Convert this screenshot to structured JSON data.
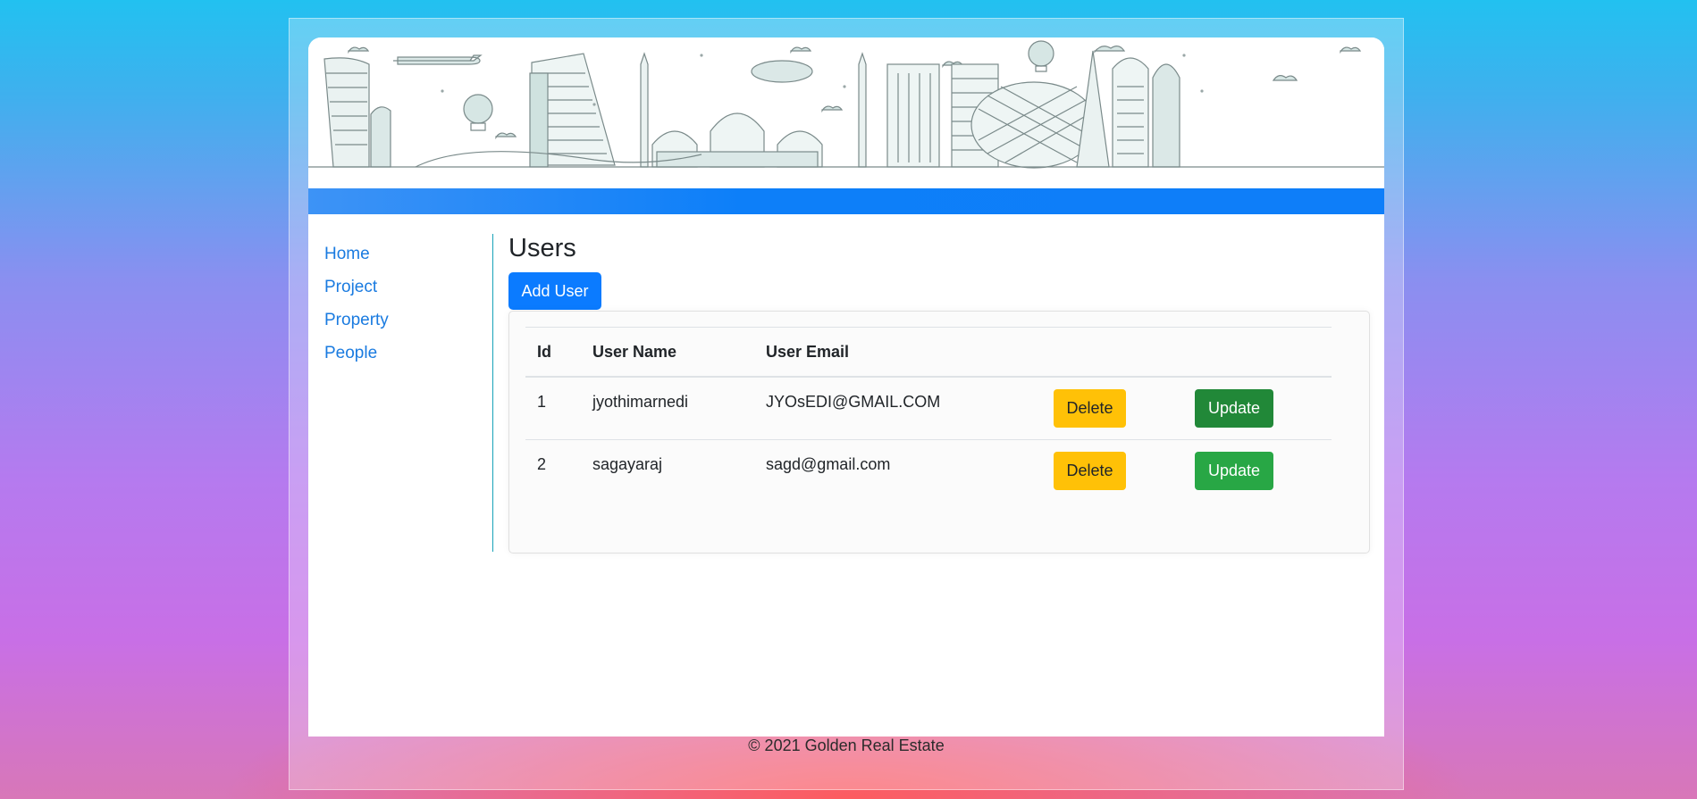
{
  "nav": {
    "items": [
      {
        "label": "Home"
      },
      {
        "label": "Project"
      },
      {
        "label": "Property"
      },
      {
        "label": "People"
      }
    ]
  },
  "main": {
    "title": "Users",
    "add_button": "Add User"
  },
  "table": {
    "headers": [
      "Id",
      "User Name",
      "User Email"
    ],
    "rows": [
      {
        "id": "1",
        "name": "jyothimarnedi",
        "email": "JYOsEDI@GMAIL.COM",
        "delete": "Delete",
        "update": "Update"
      },
      {
        "id": "2",
        "name": "sagayaraj",
        "email": "sagd@gmail.com",
        "delete": "Delete",
        "update": "Update"
      }
    ]
  },
  "footer": {
    "text": "© 2021 Golden Real Estate"
  },
  "colors": {
    "primary": "#0b7bff",
    "warning": "#ffc107",
    "success": "#28a745",
    "sidebar_divider": "#17a2b8"
  },
  "icons": {
    "banner": "city-skyline-illustration"
  }
}
